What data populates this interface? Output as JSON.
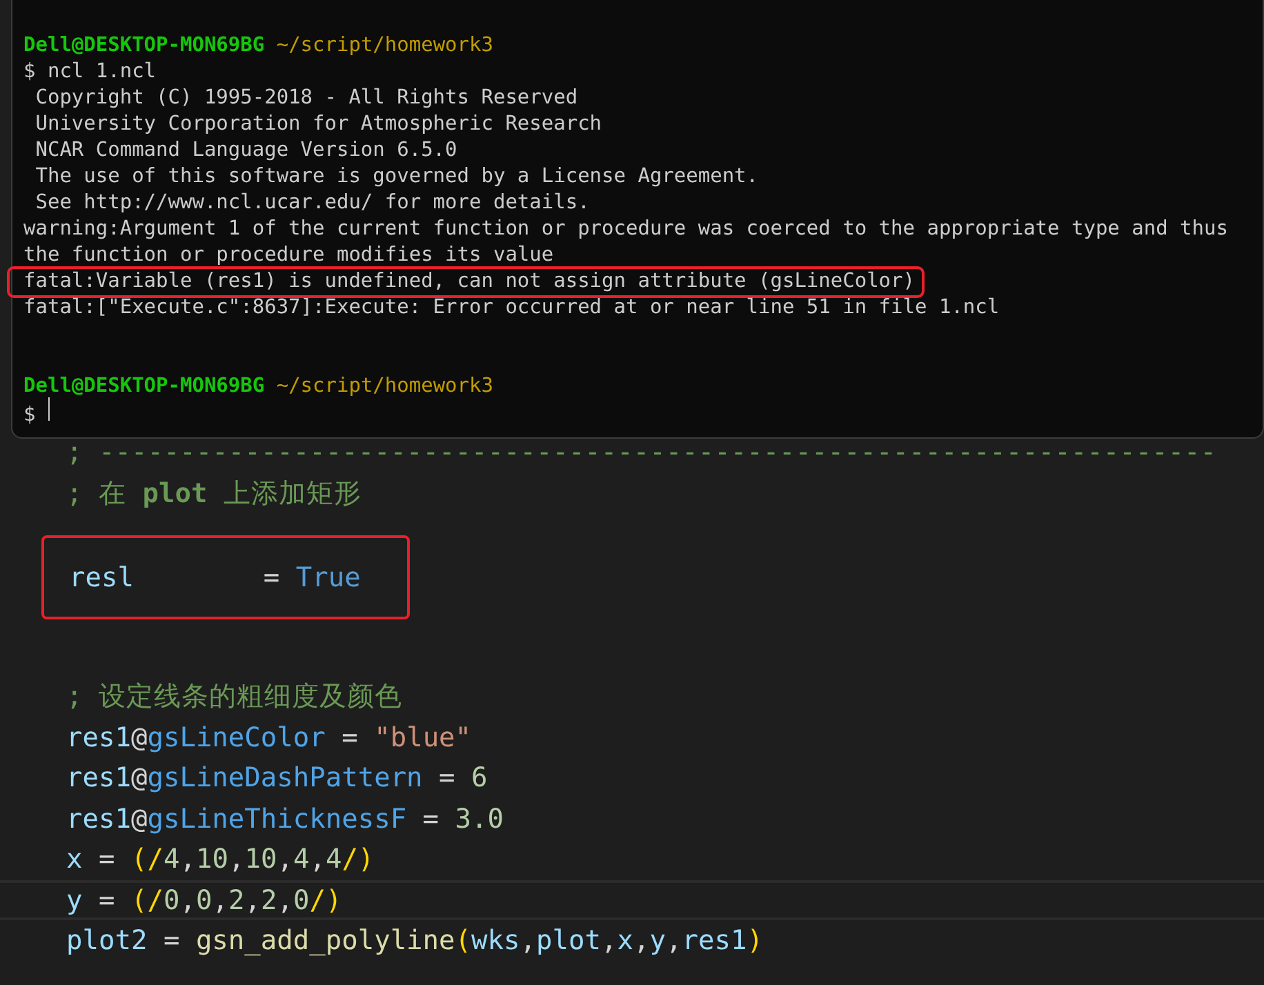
{
  "terminal": {
    "lines": [
      {
        "highlighted": false,
        "segments": [
          {
            "kind": "user",
            "text": "Dell@DESKTOP-MON69BG"
          },
          {
            "kind": "path",
            "text": " ~/script/homework3"
          }
        ]
      },
      {
        "highlighted": false,
        "segments": [
          {
            "kind": "plain",
            "text": "$ ncl 1.ncl"
          }
        ]
      },
      {
        "highlighted": false,
        "segments": [
          {
            "kind": "plain",
            "text": " Copyright (C) 1995-2018 - All Rights Reserved"
          }
        ]
      },
      {
        "highlighted": false,
        "segments": [
          {
            "kind": "plain",
            "text": " University Corporation for Atmospheric Research"
          }
        ]
      },
      {
        "highlighted": false,
        "segments": [
          {
            "kind": "plain",
            "text": " NCAR Command Language Version 6.5.0"
          }
        ]
      },
      {
        "highlighted": false,
        "segments": [
          {
            "kind": "plain",
            "text": " The use of this software is governed by a License Agreement."
          }
        ]
      },
      {
        "highlighted": false,
        "segments": [
          {
            "kind": "plain",
            "text": " See http://www.ncl.ucar.edu/ for more details."
          }
        ]
      },
      {
        "highlighted": false,
        "segments": [
          {
            "kind": "plain",
            "text": "warning:Argument 1 of the current function or procedure was coerced to the appropriate type and thus"
          }
        ]
      },
      {
        "highlighted": false,
        "segments": [
          {
            "kind": "plain",
            "text": "the function or procedure modifies its value"
          }
        ]
      },
      {
        "highlighted": true,
        "segments": [
          {
            "kind": "plain",
            "text": "fatal:Variable (res1) is undefined, can not assign attribute (gsLineColor)"
          }
        ]
      },
      {
        "highlighted": false,
        "segments": [
          {
            "kind": "plain",
            "text": "fatal:[\"Execute.c\":8637]:Execute: Error occurred at or near line 51 in file 1.ncl"
          }
        ]
      },
      {
        "kind": "blank"
      },
      {
        "kind": "blank"
      },
      {
        "highlighted": false,
        "segments": [
          {
            "kind": "user",
            "text": "Dell@DESKTOP-MON69BG"
          },
          {
            "kind": "path",
            "text": " ~/script/homework3"
          }
        ]
      },
      {
        "highlighted": false,
        "cursor": true,
        "segments": [
          {
            "kind": "plain",
            "text": "$ "
          }
        ]
      }
    ]
  },
  "editor": {
    "lines": [
      {
        "highlighted": false,
        "current": false,
        "tokens": [
          {
            "kind": "comment",
            "text": "; ---------------------------------------------------------------------"
          }
        ]
      },
      {
        "highlighted": false,
        "current": false,
        "tokens": [
          {
            "kind": "comment",
            "text": "; 在 "
          },
          {
            "kind": "comment_bold",
            "text": "plot"
          },
          {
            "kind": "comment",
            "text": " 上添加矩形"
          }
        ]
      },
      {
        "kind": "blank"
      },
      {
        "highlighted": true,
        "current": false,
        "tokens": [
          {
            "kind": "variable",
            "text": "resl"
          },
          {
            "kind": "plain",
            "text": "        = "
          },
          {
            "kind": "keyword",
            "text": "True"
          }
        ]
      },
      {
        "kind": "blank"
      },
      {
        "kind": "blank"
      },
      {
        "highlighted": false,
        "current": false,
        "tokens": [
          {
            "kind": "comment",
            "text": "; 设定线条的粗细度及颜色"
          }
        ]
      },
      {
        "highlighted": false,
        "current": false,
        "tokens": [
          {
            "kind": "variable",
            "text": "res1"
          },
          {
            "kind": "plain",
            "text": "@"
          },
          {
            "kind": "attribute",
            "text": "gsLineColor"
          },
          {
            "kind": "plain",
            "text": " = "
          },
          {
            "kind": "string",
            "text": "\"blue\""
          }
        ]
      },
      {
        "highlighted": false,
        "current": false,
        "tokens": [
          {
            "kind": "variable",
            "text": "res1"
          },
          {
            "kind": "plain",
            "text": "@"
          },
          {
            "kind": "attribute",
            "text": "gsLineDashPattern"
          },
          {
            "kind": "plain",
            "text": " = "
          },
          {
            "kind": "number",
            "text": "6"
          }
        ]
      },
      {
        "highlighted": false,
        "current": false,
        "tokens": [
          {
            "kind": "variable",
            "text": "res1"
          },
          {
            "kind": "plain",
            "text": "@"
          },
          {
            "kind": "attribute",
            "text": "gsLineThicknessF"
          },
          {
            "kind": "plain",
            "text": " = "
          },
          {
            "kind": "number",
            "text": "3.0"
          }
        ]
      },
      {
        "highlighted": false,
        "current": false,
        "tokens": [
          {
            "kind": "variable",
            "text": "x"
          },
          {
            "kind": "plain",
            "text": " = "
          },
          {
            "kind": "paren",
            "text": "(/"
          },
          {
            "kind": "number",
            "text": "4"
          },
          {
            "kind": "plain",
            "text": ","
          },
          {
            "kind": "number",
            "text": "10"
          },
          {
            "kind": "plain",
            "text": ","
          },
          {
            "kind": "number",
            "text": "10"
          },
          {
            "kind": "plain",
            "text": ","
          },
          {
            "kind": "number",
            "text": "4"
          },
          {
            "kind": "plain",
            "text": ","
          },
          {
            "kind": "number",
            "text": "4"
          },
          {
            "kind": "paren",
            "text": "/)"
          }
        ]
      },
      {
        "highlighted": false,
        "current": true,
        "tokens": [
          {
            "kind": "variable",
            "text": "y"
          },
          {
            "kind": "plain",
            "text": " = "
          },
          {
            "kind": "paren",
            "text": "(/"
          },
          {
            "kind": "number",
            "text": "0"
          },
          {
            "kind": "plain",
            "text": ","
          },
          {
            "kind": "number",
            "text": "0"
          },
          {
            "kind": "plain",
            "text": ","
          },
          {
            "kind": "number",
            "text": "2"
          },
          {
            "kind": "plain",
            "text": ","
          },
          {
            "kind": "number",
            "text": "2"
          },
          {
            "kind": "plain",
            "text": ","
          },
          {
            "kind": "number",
            "text": "0"
          },
          {
            "kind": "paren",
            "text": "/)"
          }
        ]
      },
      {
        "highlighted": false,
        "current": false,
        "tokens": [
          {
            "kind": "variable",
            "text": "plot2"
          },
          {
            "kind": "plain",
            "text": " = "
          },
          {
            "kind": "function",
            "text": "gsn_add_polyline"
          },
          {
            "kind": "paren",
            "text": "("
          },
          {
            "kind": "variable",
            "text": "wks"
          },
          {
            "kind": "plain",
            "text": ","
          },
          {
            "kind": "variable",
            "text": "plot"
          },
          {
            "kind": "plain",
            "text": ","
          },
          {
            "kind": "variable",
            "text": "x"
          },
          {
            "kind": "plain",
            "text": ","
          },
          {
            "kind": "variable",
            "text": "y"
          },
          {
            "kind": "plain",
            "text": ","
          },
          {
            "kind": "variable",
            "text": "res1"
          },
          {
            "kind": "paren",
            "text": ")"
          }
        ]
      }
    ]
  }
}
